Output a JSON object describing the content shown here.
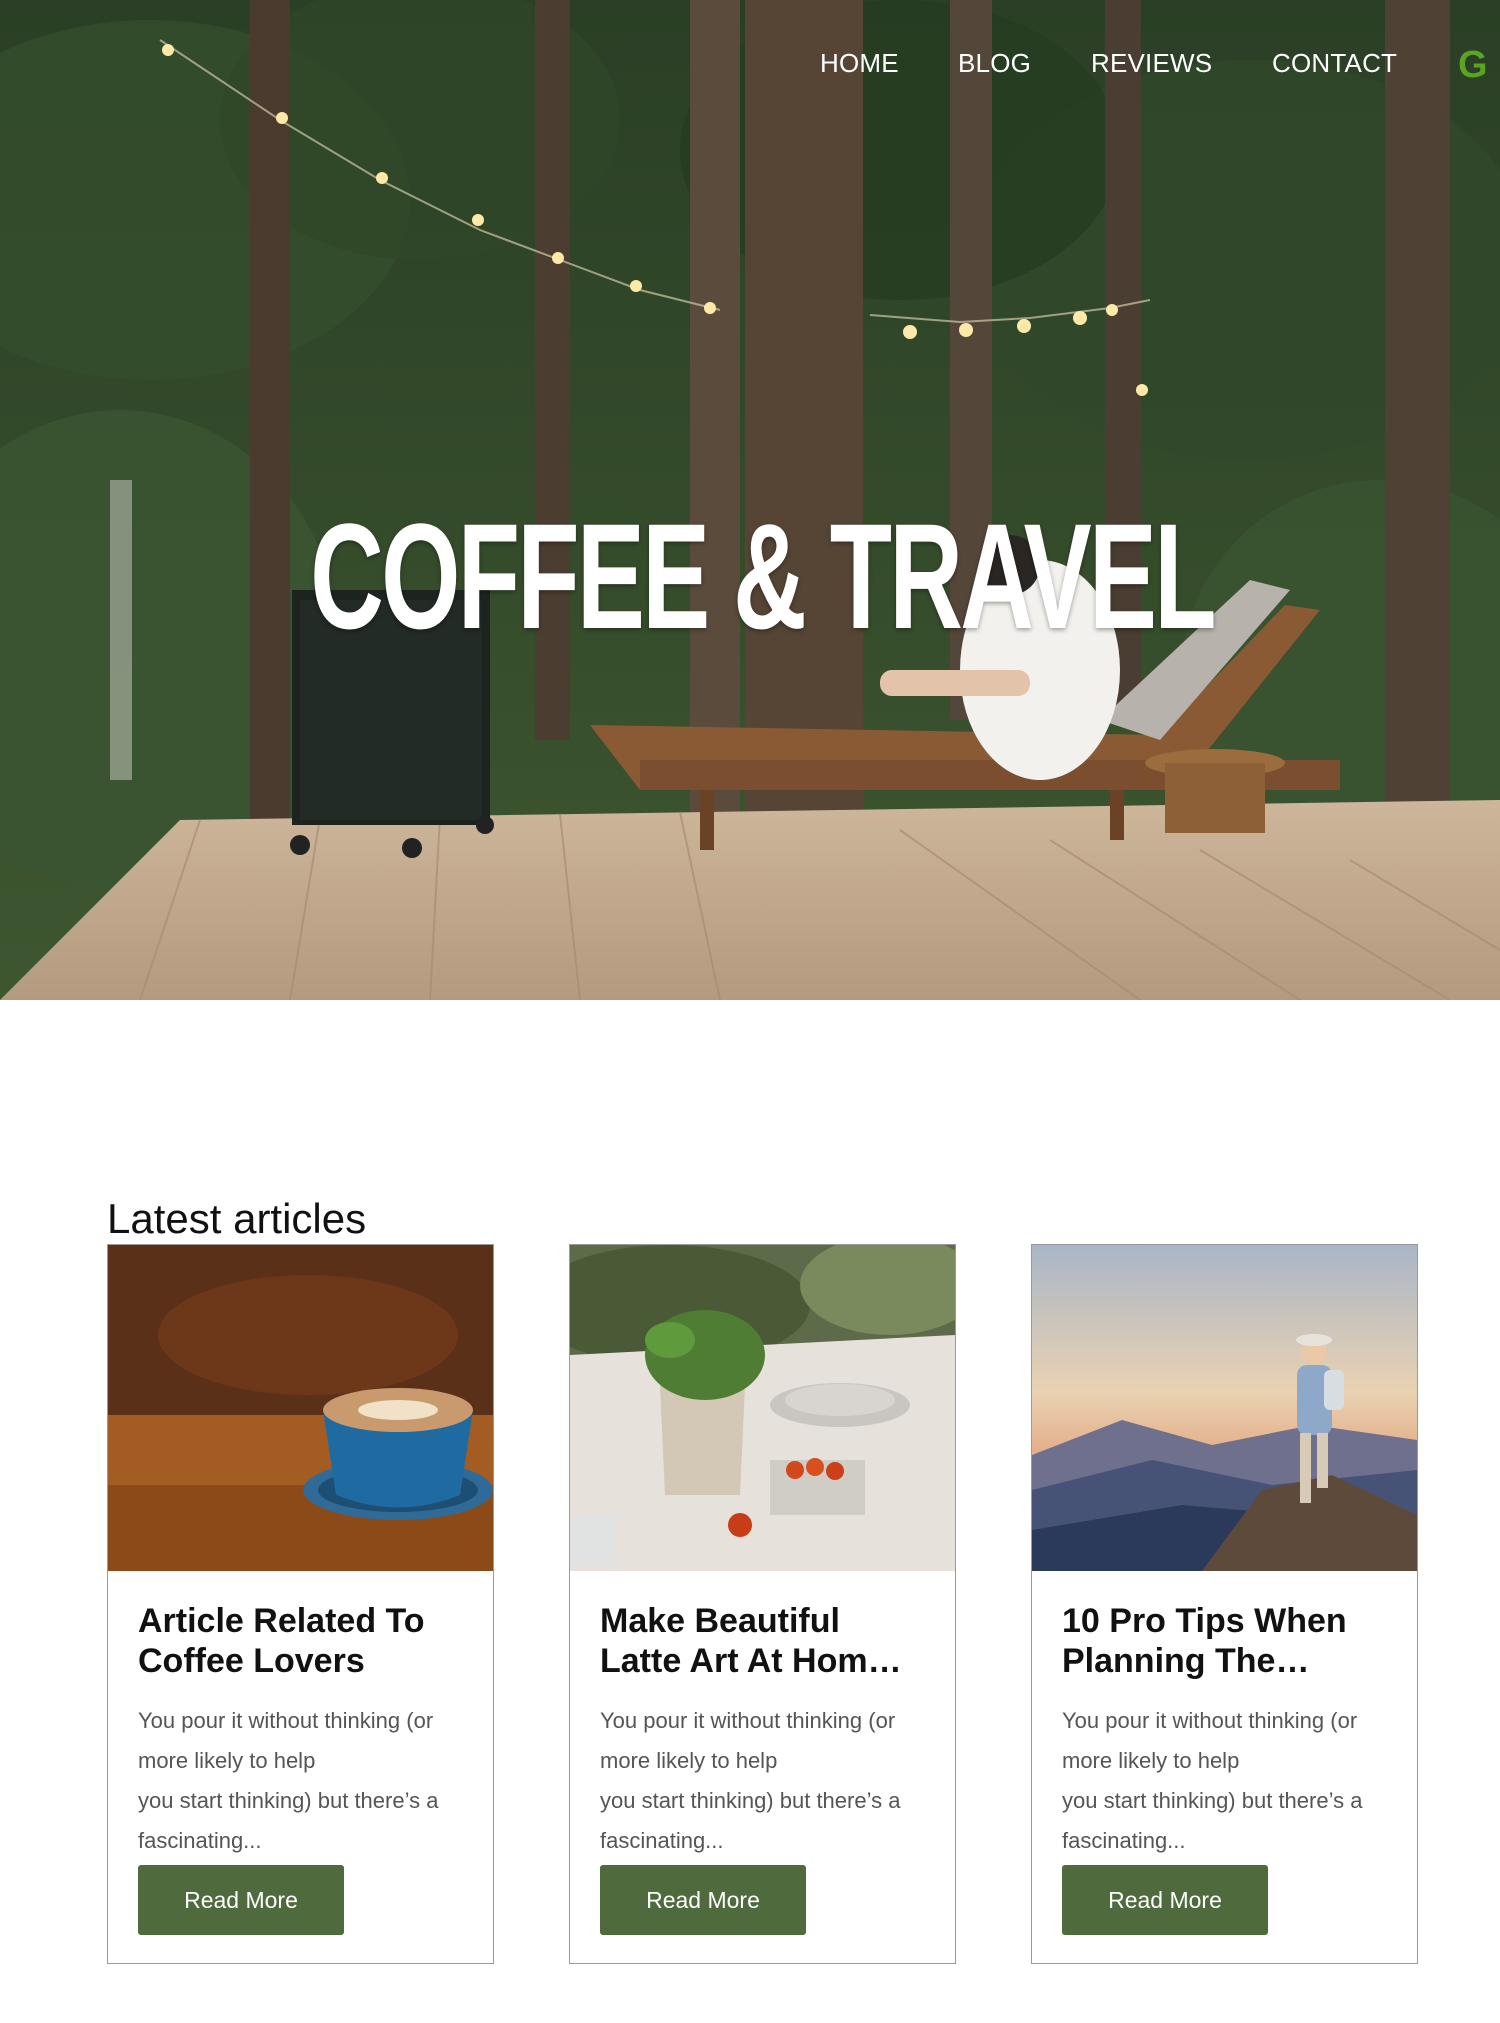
{
  "nav": {
    "items": [
      "HOME",
      "BLOG",
      "REVIEWS",
      "CONTACT"
    ],
    "logo_letter": "G"
  },
  "hero": {
    "title": "COFFEE & TRAVEL"
  },
  "section": {
    "heading": "Latest articles"
  },
  "cards": [
    {
      "title_lines": [
        "Article Related To",
        "Coffee Lovers"
      ],
      "excerpt_lines": [
        "You pour it without thinking (or",
        "more likely to help",
        "you start thinking) but there’s a",
        "fascinating..."
      ],
      "button": "Read More"
    },
    {
      "title_lines": [
        "Make Beautiful",
        "Latte Art At Hom…"
      ],
      "excerpt_lines": [
        "You pour it without thinking (or",
        "more likely to help",
        "you start thinking) but there’s a",
        "fascinating..."
      ],
      "button": "Read More"
    },
    {
      "title_lines": [
        "10 Pro Tips When",
        "Planning The…"
      ],
      "excerpt_lines": [
        "You pour it without thinking (or",
        "more likely to help",
        "you start thinking) but there’s a",
        "fascinating..."
      ],
      "button": "Read More"
    }
  ],
  "colors": {
    "accent_button": "#4f6a3c",
    "logo_green": "#5aa323",
    "nav_text": "#ffffff"
  }
}
